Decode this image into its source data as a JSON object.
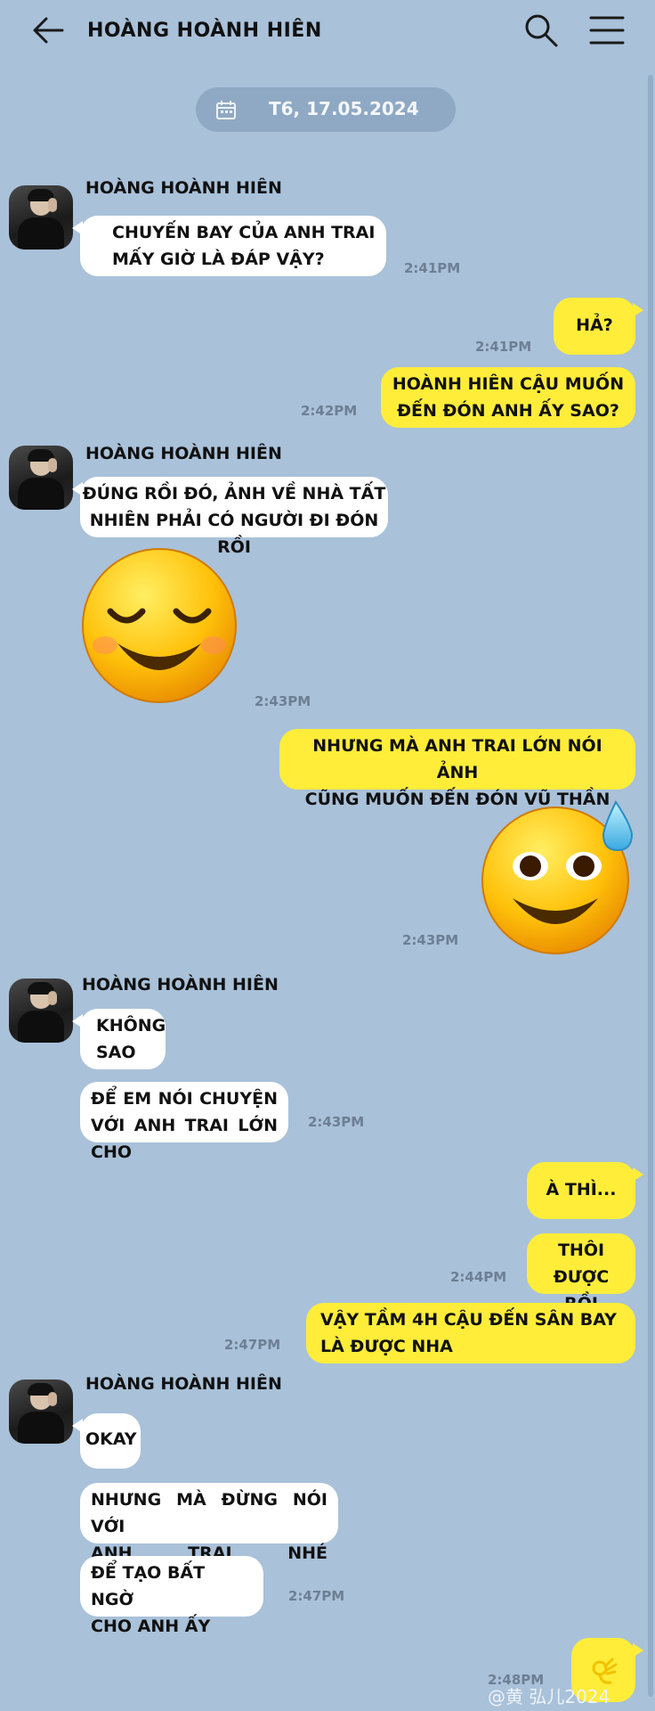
{
  "header": {
    "title": "HOÀNG HOÀNH HIÊN",
    "back_icon": "arrow-left-icon",
    "search_icon": "search-icon",
    "menu_icon": "menu-icon"
  },
  "date_pill": {
    "text": "T6, 17.05.2024",
    "icon": "calendar-icon"
  },
  "messages": [
    {
      "sender": "HOÀNG HOÀNH HIÊN",
      "text": "CHUYẾN BAY CỦA ANH TRAI\nMẤY GIỜ LÀ ĐÁP VẬY?",
      "time": "2:41PM"
    },
    {
      "text": "HẢ?",
      "time": "2:41PM"
    },
    {
      "text": "HOÀNH HIÊN CẬU MUỐN\nĐẾN ĐÓN ANH ẤY SAO?",
      "time": "2:42PM"
    },
    {
      "sender": "HOÀNG HOÀNH HIÊN",
      "text": "ĐÚNG RỒI ĐÓ, ẢNH VỀ NHÀ TẤT\nNHIÊN PHẢI CÓ NGƯỜI ĐI ĐÓN RỒI"
    },
    {
      "emoji": "relieved-face",
      "time": "2:43PM"
    },
    {
      "text": "NHƯNG MÀ ANH TRAI LỚN NÓI ẢNH\nCŨNG MUỐN ĐẾN ĐÓN VŨ THẦN"
    },
    {
      "emoji": "smiling-face-with-sweat",
      "time": "2:43PM"
    },
    {
      "sender": "HOÀNG HOÀNH HIÊN",
      "text": "KHÔNG\nSAO"
    },
    {
      "text": "ĐỂ EM NÓI CHUYỆN\nVỚI ANH TRAI LỚN CHO",
      "time": "2:43PM"
    },
    {
      "text": "À THÌ..."
    },
    {
      "text": "THÔI ĐƯỢC\nRỒI",
      "time": "2:44PM"
    },
    {
      "text": "VẬY TẦM 4H CẬU ĐẾN SÂN BAY\nLÀ ĐƯỢC NHA",
      "time": "2:47PM"
    },
    {
      "sender": "HOÀNG HOÀNH HIÊN",
      "text": "OKAY"
    },
    {
      "text": "NHƯNG MÀ ĐỪNG NÓI VỚI\nANH TRAI NHÉ"
    },
    {
      "text": "ĐỂ TẠO BẤT NGỜ\nCHO ANH ẤY",
      "time": "2:47PM"
    },
    {
      "emoji": "ok-hand",
      "time": "2:48PM"
    }
  ],
  "watermark": "@黄  弘儿2024",
  "colors": {
    "background": "#a9c1d9",
    "outgoing": "#ffed3a",
    "incoming": "#ffffff",
    "time": "#6d7f93"
  }
}
